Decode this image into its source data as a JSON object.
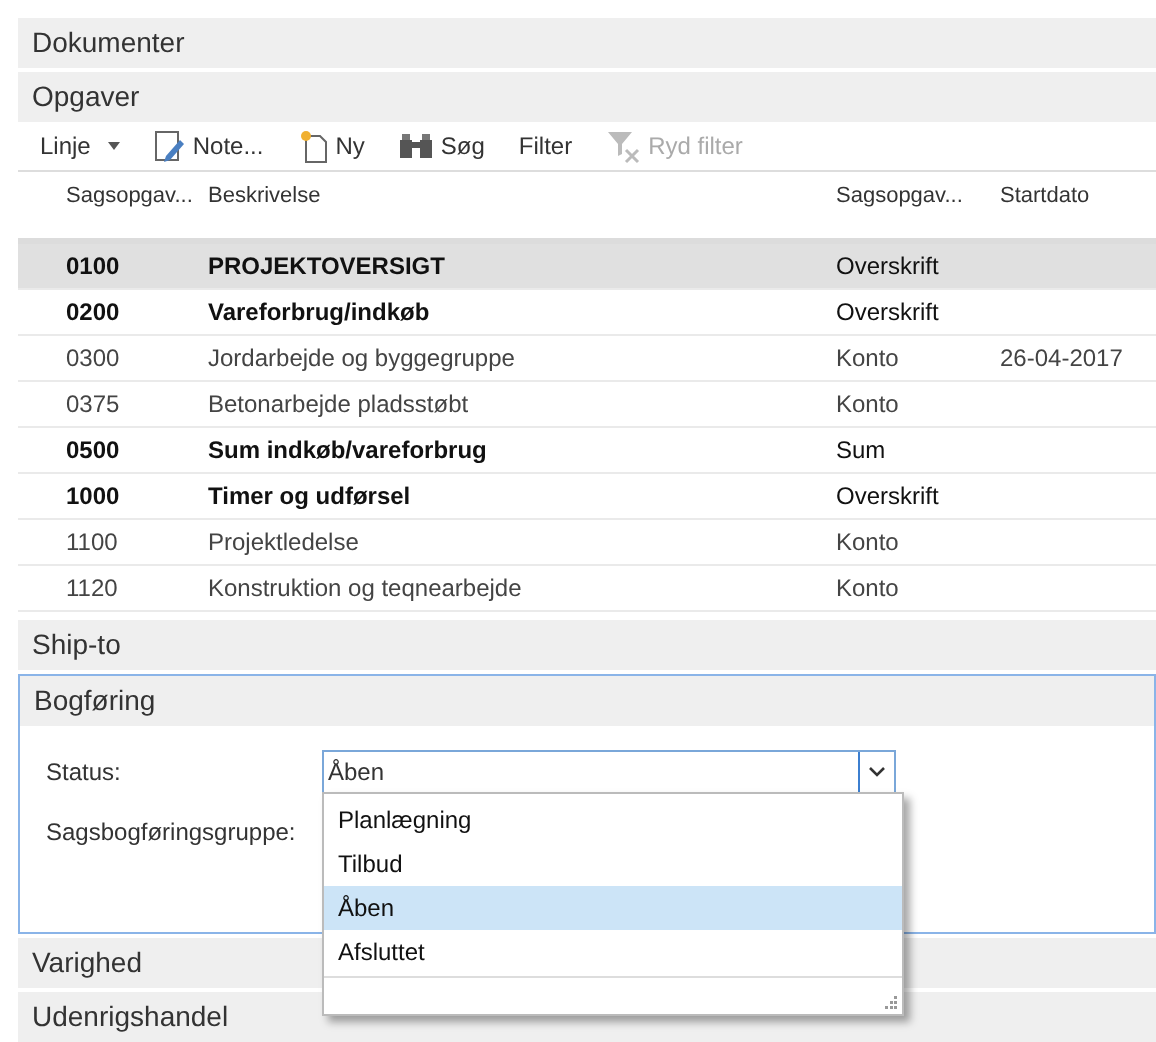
{
  "sections_top": [
    {
      "title": "Dokumenter"
    },
    {
      "title": "Opgaver"
    }
  ],
  "toolbar": [
    {
      "kind": "menu",
      "label": "Linje",
      "disabled": false
    },
    {
      "kind": "note",
      "label": "Note...",
      "disabled": false
    },
    {
      "kind": "new",
      "label": "Ny",
      "disabled": false
    },
    {
      "kind": "search",
      "label": "Søg",
      "disabled": false
    },
    {
      "kind": "text",
      "label": "Filter",
      "disabled": false
    },
    {
      "kind": "clear",
      "label": "Ryd filter",
      "disabled": true
    }
  ],
  "table": {
    "columns": [
      "Sagsopgav...",
      "Beskrivelse",
      "Sagsopgav...",
      "Startdato"
    ],
    "rows": [
      {
        "cells": [
          "0100",
          "PROJEKTOVERSIGT",
          "Overskrift",
          ""
        ],
        "bold": true,
        "selected": true
      },
      {
        "cells": [
          "0200",
          "Vareforbrug/indkøb",
          "Overskrift",
          ""
        ],
        "bold": true,
        "selected": false
      },
      {
        "cells": [
          "0300",
          "Jordarbejde og byggegruppe",
          "Konto",
          "26-04-2017"
        ],
        "bold": false,
        "selected": false
      },
      {
        "cells": [
          "0375",
          "Betonarbejde pladsstøbt",
          "Konto",
          ""
        ],
        "bold": false,
        "selected": false
      },
      {
        "cells": [
          "0500",
          "Sum indkøb/vareforbrug",
          "Sum",
          ""
        ],
        "bold": true,
        "selected": false
      },
      {
        "cells": [
          "1000",
          "Timer og udførsel",
          "Overskrift",
          ""
        ],
        "bold": true,
        "selected": false
      },
      {
        "cells": [
          "1100",
          "Projektledelse",
          "Konto",
          ""
        ],
        "bold": false,
        "selected": false
      },
      {
        "cells": [
          "1120",
          "Konstruktion og teqnearbejde",
          "Konto",
          ""
        ],
        "bold": false,
        "selected": false
      }
    ]
  },
  "ship_to": {
    "title": "Ship-to"
  },
  "bogforing": {
    "title": "Bogføring",
    "focused": true,
    "fields": [
      {
        "label": "Status:",
        "kind": "select",
        "value": "Åben"
      },
      {
        "label": "Sagsbogføringsgruppe:",
        "kind": "text"
      }
    ],
    "dropdown": {
      "options": [
        {
          "label": "Planlægning",
          "selected": false
        },
        {
          "label": "Tilbud",
          "selected": false
        },
        {
          "label": "Åben",
          "selected": true
        },
        {
          "label": "Afsluttet",
          "selected": false
        }
      ]
    }
  },
  "sections_bottom": [
    {
      "title": "Varighed"
    },
    {
      "title": "Udenrigshandel"
    }
  ]
}
